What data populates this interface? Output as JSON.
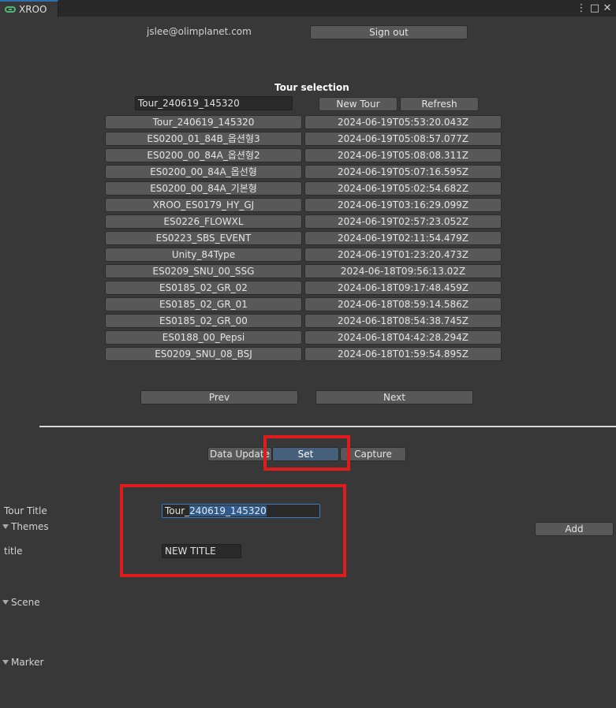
{
  "window": {
    "tab_title": "XROO",
    "menu_icon": "⋮",
    "maximize_icon": "□",
    "close_icon": "✕"
  },
  "account": {
    "email": "jslee@olimplanet.com",
    "sign_out_label": "Sign out"
  },
  "tour_selection": {
    "heading": "Tour selection",
    "search_value": "Tour_240619_145320",
    "new_tour_label": "New Tour",
    "refresh_label": "Refresh",
    "tours": [
      {
        "name": "Tour_240619_145320",
        "date": "2024-06-19T05:53:20.043Z"
      },
      {
        "name": "ES0200_01_84B_옵션형3",
        "date": "2024-06-19T05:08:57.077Z"
      },
      {
        "name": "ES0200_00_84A_옵션형2",
        "date": "2024-06-19T05:08:08.311Z"
      },
      {
        "name": "ES0200_00_84A_옵선형",
        "date": "2024-06-19T05:07:16.595Z"
      },
      {
        "name": "ES0200_00_84A_기본형",
        "date": "2024-06-19T05:02:54.682Z"
      },
      {
        "name": "XROO_ES0179_HY_GJ",
        "date": "2024-06-19T03:16:29.099Z"
      },
      {
        "name": "ES0226_FLOWXL",
        "date": "2024-06-19T02:57:23.052Z"
      },
      {
        "name": "ES0223_SBS_EVENT",
        "date": "2024-06-19T02:11:54.479Z"
      },
      {
        "name": "Unity_84Type",
        "date": "2024-06-19T01:23:20.473Z"
      },
      {
        "name": "ES0209_SNU_00_SSG",
        "date": "2024-06-18T09:56:13.02Z"
      },
      {
        "name": "ES0185_02_GR_02",
        "date": "2024-06-18T09:17:48.459Z"
      },
      {
        "name": "ES0185_02_GR_01",
        "date": "2024-06-18T08:59:14.586Z"
      },
      {
        "name": "ES0185_02_GR_00",
        "date": "2024-06-18T08:54:38.745Z"
      },
      {
        "name": "ES0188_00_Pepsi",
        "date": "2024-06-18T04:42:28.294Z"
      },
      {
        "name": "ES0209_SNU_08_BSJ",
        "date": "2024-06-18T01:59:54.895Z"
      }
    ],
    "prev_label": "Prev",
    "next_label": "Next"
  },
  "mode_tabs": {
    "data_update": "Data Update",
    "set": "Set",
    "capture": "Capture",
    "active": "Set"
  },
  "editor": {
    "tour_title_label": "Tour Title",
    "tour_title_prefix": "Tour_",
    "tour_title_selected": "240619_145320",
    "themes_label": "Themes",
    "add_label": "Add",
    "title_label": "title",
    "title_value": "NEW TITLE",
    "scene_label": "Scene",
    "marker_label": "Marker"
  },
  "colors": {
    "background": "#383838",
    "button": "#585858",
    "active_button": "#46607c",
    "highlight": "#e01b1b",
    "tab_accent": "#2f6fb0"
  }
}
